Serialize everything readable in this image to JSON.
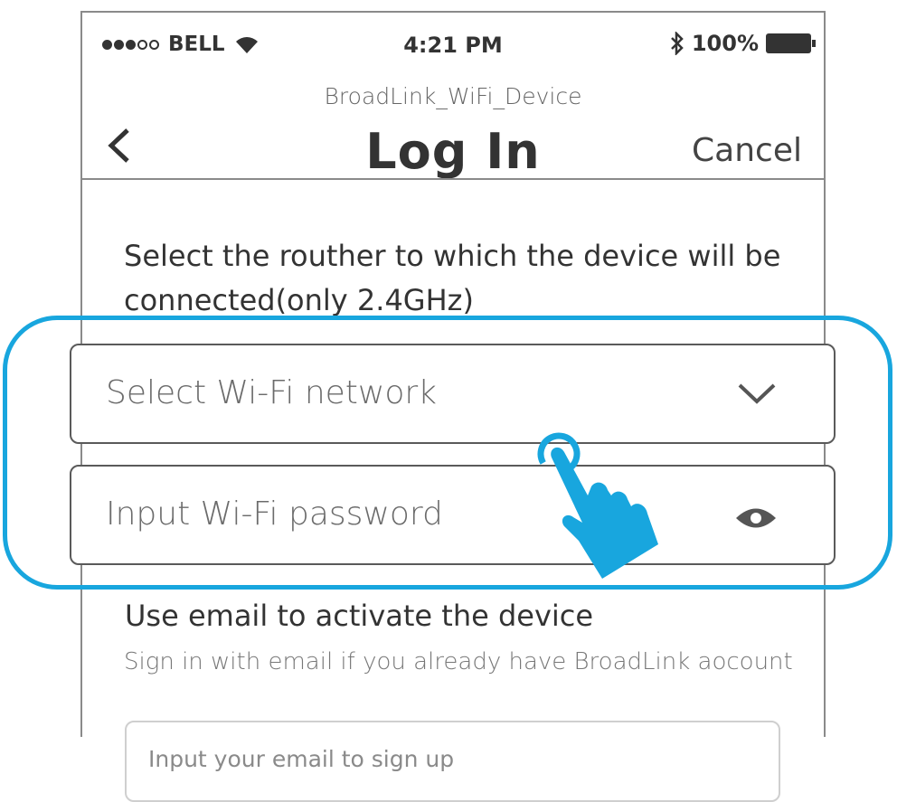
{
  "status_bar": {
    "carrier": "BELL",
    "time": "4:21 PM",
    "battery": "100%"
  },
  "header": {
    "subtitle": "BroadLink_WiFi_Device",
    "title": "Log In",
    "cancel_label": "Cancel"
  },
  "main": {
    "instruction": "Select the routher to which the device will be connected(only 2.4GHz)",
    "wifi_select_placeholder": "Select Wi-Fi network",
    "password_placeholder": "Input Wi-Fi password",
    "email_heading": "Use email to activate the device",
    "email_description": "Sign in with email if you already have BroadLink aocount",
    "email_placeholder": "Input your email to sign up"
  },
  "colors": {
    "highlight": "#18a6de",
    "text": "#333333"
  },
  "icons": {
    "back": "chevron-left-icon",
    "dropdown": "chevron-down-icon",
    "eye": "eye-icon",
    "wifi": "wifi-icon",
    "bluetooth": "bluetooth-icon",
    "battery": "battery-icon",
    "hand": "tap-hand-icon"
  }
}
